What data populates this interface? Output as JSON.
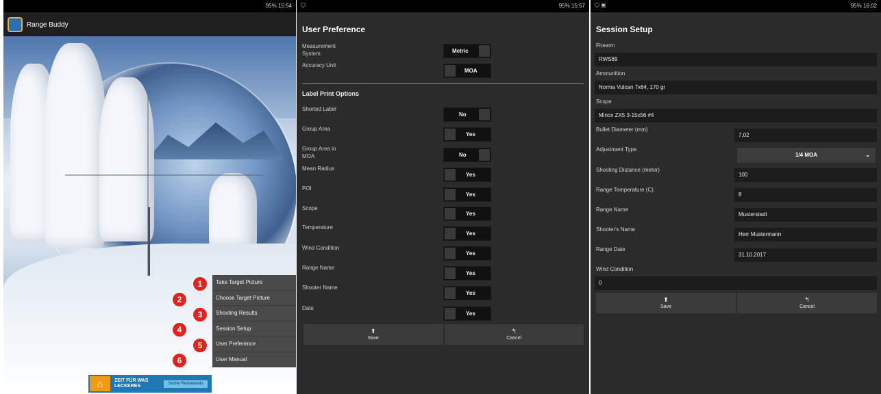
{
  "screen1": {
    "status": "95% 15:54",
    "app_title": "Range Buddy",
    "menu": [
      {
        "num": "1",
        "label": "Take Target Picture"
      },
      {
        "num": "2",
        "label": "Choose Target Picture"
      },
      {
        "num": "3",
        "label": "Shooting Results"
      },
      {
        "num": "4",
        "label": "Session Setup"
      },
      {
        "num": "5",
        "label": "User Preference"
      },
      {
        "num": "6",
        "label": "User Manual"
      }
    ],
    "ad": {
      "line1": "ZEIT FÜR WAS",
      "line2": "LECKERES",
      "button": "Suche Restaurants"
    }
  },
  "screen2": {
    "status": "95% 15:57",
    "title": "User Preference",
    "measurement_label": "Measurement System",
    "measurement_value": "Metric",
    "accuracy_label": "Accuracy Unit",
    "accuracy_value": "MOA",
    "section_title": "Label Print Options",
    "options": [
      {
        "label": "Shorted Label",
        "value": "No"
      },
      {
        "label": "Group Area",
        "value": "Yes"
      },
      {
        "label": "Group Area in MOA",
        "value": "No"
      },
      {
        "label": "Mean Radius",
        "value": "Yes"
      },
      {
        "label": "POI",
        "value": "Yes"
      },
      {
        "label": "Scope",
        "value": "Yes"
      },
      {
        "label": "Temperature",
        "value": "Yes"
      },
      {
        "label": "Wind Condition",
        "value": "Yes"
      },
      {
        "label": "Range Name",
        "value": "Yes"
      },
      {
        "label": "Shooter Name",
        "value": "Yes"
      },
      {
        "label": "Date",
        "value": "Yes"
      }
    ],
    "save": "Save",
    "cancel": "Cancel"
  },
  "screen3": {
    "status": "95% 16:02",
    "title": "Session Setup",
    "firearm_label": "Firearm",
    "firearm_value": "RWS89",
    "ammo_label": "Ammunition",
    "ammo_value": "Norma Vulcan 7x64, 170 gr",
    "scope_label": "Scope",
    "scope_value": "Minox ZX5 3-15x56 #4",
    "bullet_label": "Bullet Diameter (mm)",
    "bullet_value": "7,02",
    "adjust_label": "Adjustment Type",
    "adjust_value": "1/4 MOA",
    "distance_label": "Shooting Distance (meter)",
    "distance_value": "100",
    "temp_label": "Range Temperature (C)",
    "temp_value": "8",
    "range_label": "Range Name",
    "range_value": "Musterstadt",
    "shooter_label": "Shooter's Name",
    "shooter_value": "Herr Mustermann",
    "date_label": "Range Date",
    "date_value": "31.10.2017",
    "wind_label": "Wind Condition",
    "wind_value": "0",
    "save": "Save",
    "cancel": "Cancel"
  }
}
